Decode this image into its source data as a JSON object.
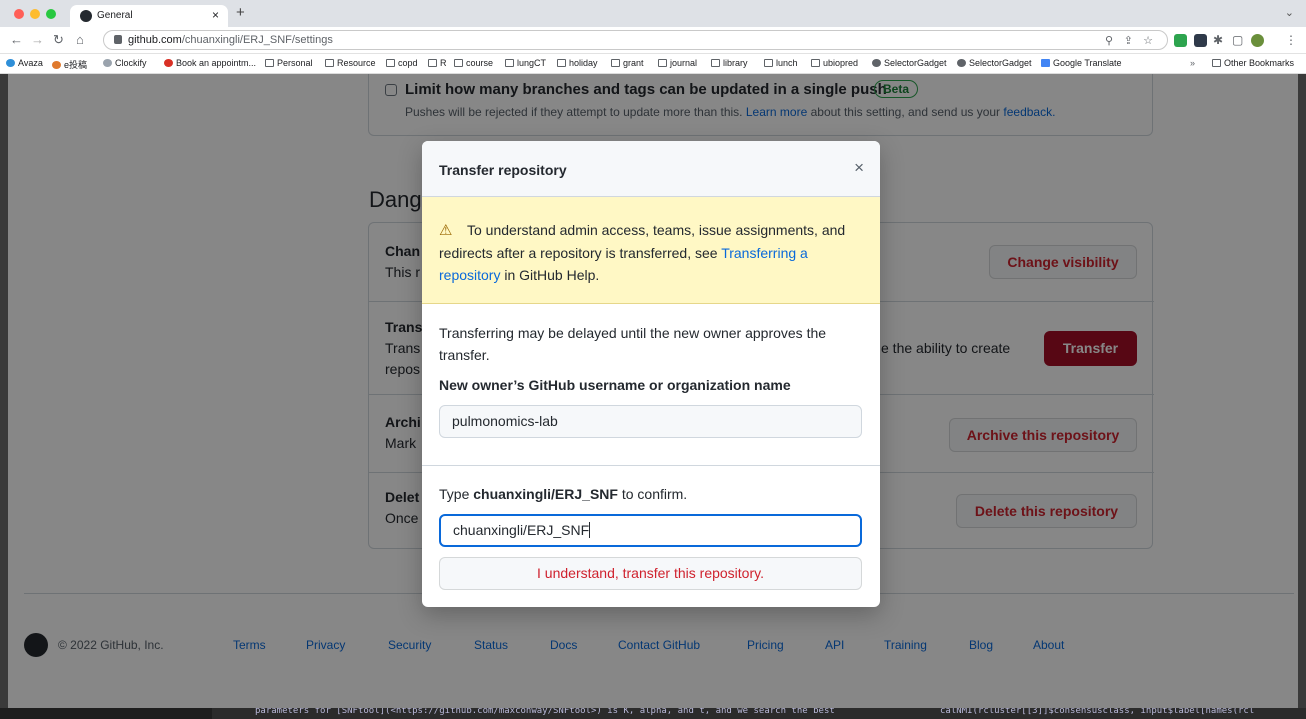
{
  "browser": {
    "tab_title": "General",
    "tab_close": "×",
    "new_tab": "+",
    "tab_menu": "⌄",
    "url_host": "github.com",
    "url_path": "/chuanxingli/ERJ_SNF/settings",
    "bookmarks": [
      "Avaza",
      "e投稿",
      "Clockify",
      "Book an appointm...",
      "Personal",
      "Resource",
      "copd",
      "R",
      "course",
      "lungCT",
      "holiday",
      "grant",
      "journal",
      "library",
      "lunch",
      "ubiopred",
      "SelectorGadget",
      "SelectorGadget",
      "Google Translate"
    ],
    "bookmarks_more": "»",
    "other_bookmarks": "Other Bookmarks"
  },
  "settings": {
    "limit_push_title": "Limit how many branches and tags can be updated in a single push",
    "limit_push_badge": "Beta",
    "limit_push_desc_pre": "Pushes will be rejected if they attempt to update more than this.",
    "limit_push_learn_more": "Learn more",
    "limit_push_desc_mid": "about this setting, and send us your",
    "limit_push_feedback": "feedback.",
    "danger_zone_heading": "Dang",
    "rows": [
      {
        "title": "Chan",
        "desc": "This r",
        "button": "Change visibility"
      },
      {
        "title": "Trans",
        "desc": "Trans",
        "desc2": "repos",
        "desc_right": "e the ability to create",
        "button": "Transfer"
      },
      {
        "title": "Archi",
        "desc": "Mark",
        "button": "Archive this repository"
      },
      {
        "title": "Delet",
        "desc": "Once",
        "button": "Delete this repository"
      }
    ]
  },
  "footer": {
    "copyright": "© 2022 GitHub, Inc.",
    "links": [
      "Terms",
      "Privacy",
      "Security",
      "Status",
      "Docs",
      "Contact GitHub",
      "Pricing",
      "API",
      "Training",
      "Blog",
      "About"
    ]
  },
  "modal": {
    "title": "Transfer repository",
    "close": "×",
    "warning_icon": "⚠",
    "warning_pre": "To understand admin access, teams, issue assignments, and redirects after a repository is transferred, see",
    "warning_link": "Transferring a repository",
    "warning_post": "in GitHub Help.",
    "delay_text": "Transferring may be delayed until the new owner approves the transfer.",
    "new_owner_label": "New owner’s GitHub username or organization name",
    "new_owner_value": "pulmonomics-lab",
    "confirm_pre": "Type",
    "confirm_repo": "chuanxingli/ERJ_SNF",
    "confirm_post": "to confirm.",
    "confirm_value": "chuanxingli/ERJ_SNF",
    "submit": "I understand, transfer this repository."
  },
  "terminal": {
    "left_text": "parameters for [SNFtool](<https://github.com/maxconway/SNFtool>) is K, alpha, and t, and we search the best",
    "right_text": "calNMI(rcluster[[3]]$consensusclass, input$label[names(rcl"
  },
  "colors": {
    "danger": "#cf222e",
    "transfer_button": "#a40e26",
    "link": "#0969da",
    "flash_bg": "#fff8c5"
  }
}
